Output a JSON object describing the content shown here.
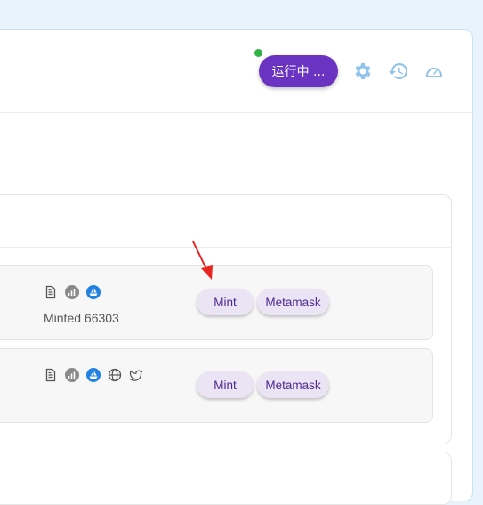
{
  "toolbar": {
    "run_label": "运行中 ...",
    "status_color": "#2fb344",
    "accent_color": "#6a33c2",
    "icons": [
      "gear-icon",
      "history-icon",
      "speedometer-icon"
    ]
  },
  "rows": [
    {
      "icons": [
        "document-icon",
        "chart-icon",
        "ship-icon"
      ],
      "minted_text": "Minted 66303",
      "mint_label": "Mint",
      "metamask_label": "Metamask"
    },
    {
      "icons": [
        "document-icon",
        "chart-icon",
        "ship-icon",
        "globe-icon",
        "twitter-icon"
      ],
      "minted_text": "",
      "mint_label": "Mint",
      "metamask_label": "Metamask"
    }
  ],
  "annotation": {
    "arrow_color": "#e8251f"
  }
}
